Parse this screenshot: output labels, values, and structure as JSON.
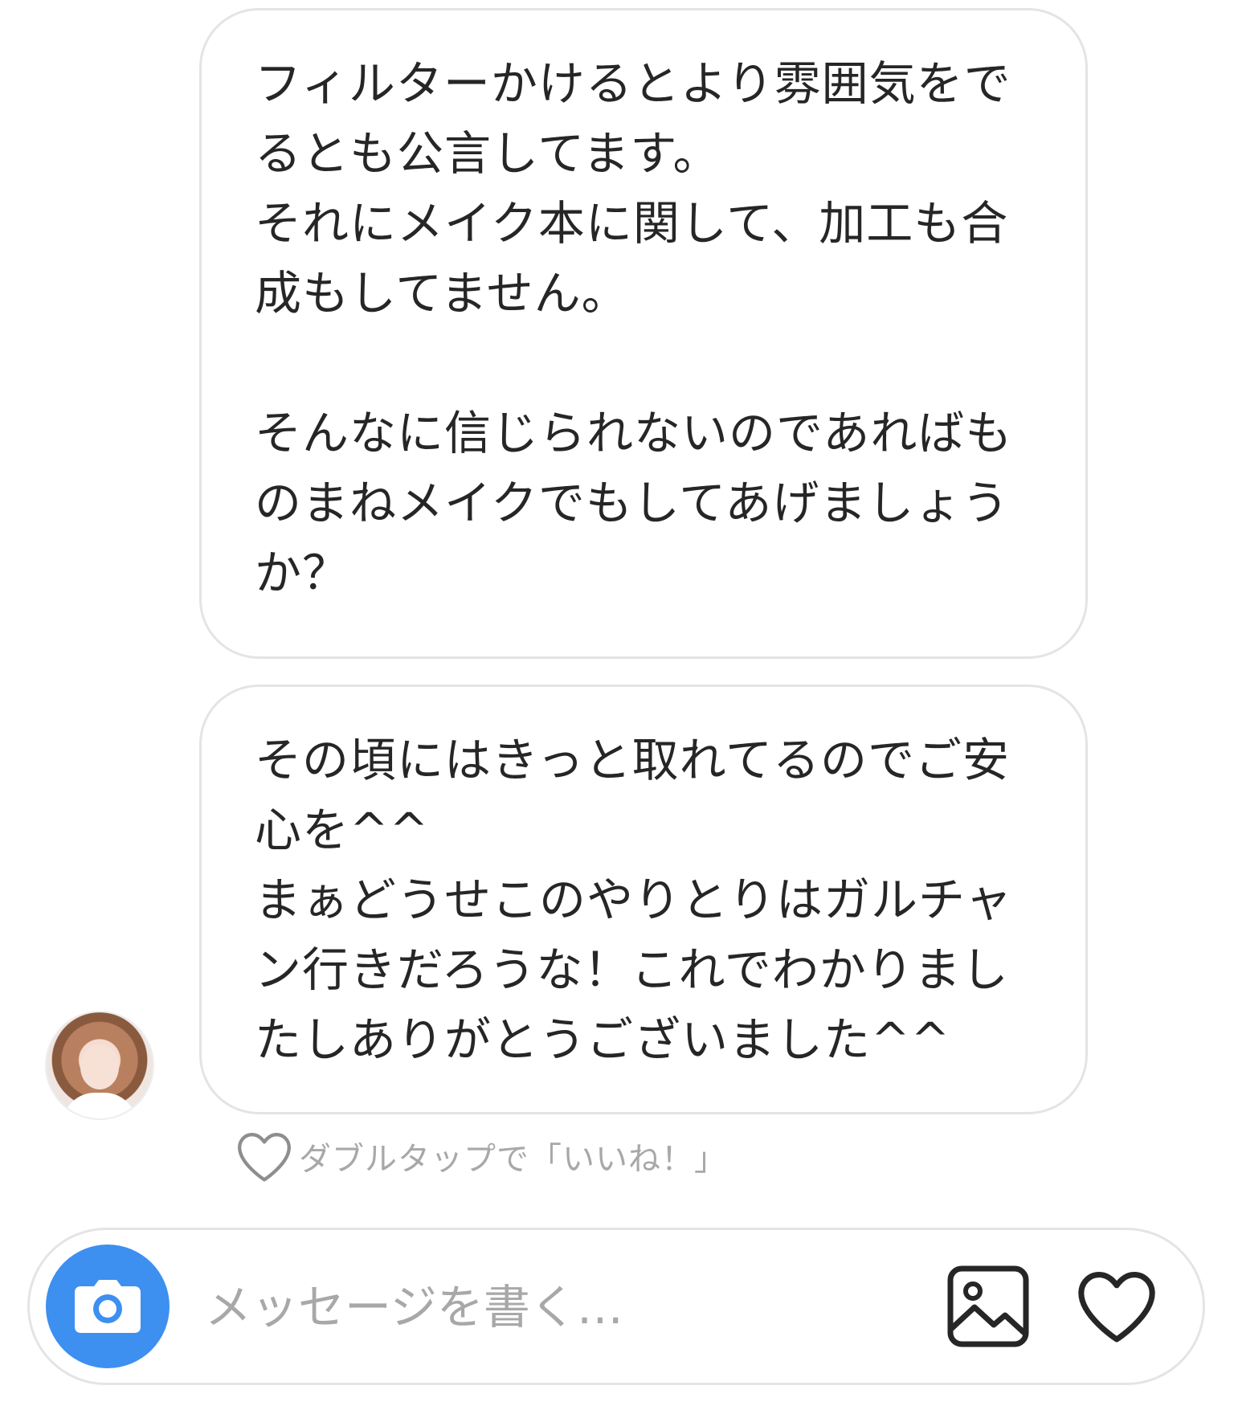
{
  "thread": {
    "messages": [
      {
        "lines": [
          "フィルターかけるとより雰囲気をで",
          "るとも公言してます。",
          "それにメイク本に関して、加工も合",
          "成もしてません。",
          "",
          "そんなに信じられないのであればも",
          "のまねメイクでもしてあげましょう",
          "か？"
        ]
      },
      {
        "lines": [
          "その頃にはきっと取れてるのでご安",
          "心を^^",
          "まぁどうせこのやりとりはガルチャ",
          "ン行きだろうな！これでわかりまし",
          "たしありがとうございました^^"
        ]
      }
    ],
    "like_hint": "ダブルタップで「いいね！」"
  },
  "composer": {
    "placeholder": "メッセージを書く…",
    "camera_icon": "camera-icon",
    "gallery_icon": "image-icon",
    "like_icon": "heart-icon"
  },
  "colors": {
    "accent": "#3d8ff0",
    "bubble_border": "#e4e4e4",
    "hint_text": "#a8a8a8",
    "text": "#262626"
  }
}
